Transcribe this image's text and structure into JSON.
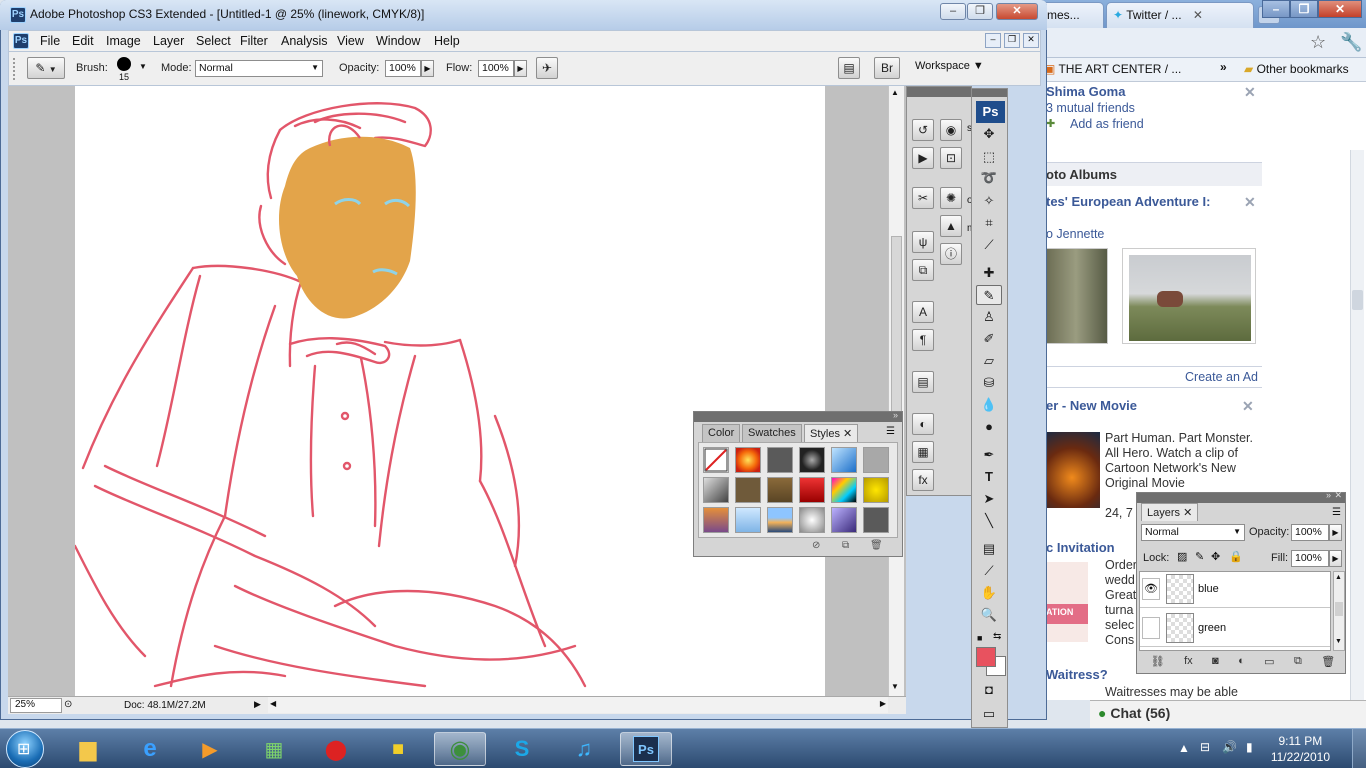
{
  "browser": {
    "tabs": [
      {
        "label": "mes..."
      },
      {
        "label": "Twitter / ..."
      }
    ],
    "bookmarks": [
      {
        "label": "THE ART CENTER / ..."
      },
      {
        "label": "Other bookmarks"
      }
    ],
    "facebook": {
      "friend_name": "Shima Goma",
      "mutual_friends": "3 mutual friends",
      "add_friend": "Add as friend",
      "photo_albums_heading": "oto Albums",
      "album_title": "tes' European Adventure I:",
      "album_owner": "o Jennette",
      "create_ad": "Create an Ad",
      "ad1_title": "er - New Movie",
      "ad1_text": "Part Human. Part Monster. All Hero. Watch a clip of Cartoon Network's New Original Movie",
      "ad1_text2": "24, 7",
      "ad2_title": "c Invitation",
      "ad2_lines": [
        "Order",
        "wedd",
        "Great",
        "turna",
        "selec",
        "Cons"
      ],
      "ad2_image_text": "ATION",
      "ad3_title": "Waitress?",
      "ad3_text": "Waitresses may be able"
    },
    "chat_label": "Chat (56)"
  },
  "photoshop": {
    "title": "Adobe Photoshop CS3 Extended - [Untitled-1 @ 25% (linework, CMYK/8)]",
    "menu": [
      "File",
      "Edit",
      "Image",
      "Layer",
      "Select",
      "Filter",
      "Analysis",
      "View",
      "Window",
      "Help"
    ],
    "options": {
      "brush_label": "Brush:",
      "brush_size": "15",
      "mode_label": "Mode:",
      "mode_value": "Normal",
      "opacity_label": "Opacity:",
      "opacity_value": "100%",
      "flow_label": "Flow:",
      "flow_value": "100%",
      "workspace_label": "Workspace"
    },
    "status": {
      "zoom": "25%",
      "doc": "Doc: 48.1M/27.2M"
    },
    "dock_partial_labels": [
      "s",
      "or",
      "m"
    ],
    "swatch_panel": {
      "tabs": [
        "Color",
        "Swatches",
        "Styles"
      ],
      "active_tab": "Styles"
    },
    "layers_panel": {
      "tab": "Layers",
      "blend_mode": "Normal",
      "opacity_label": "Opacity:",
      "opacity_value": "100%",
      "lock_label": "Lock:",
      "fill_label": "Fill:",
      "fill_value": "100%",
      "layers": [
        {
          "name": "blue",
          "visible": true
        },
        {
          "name": "green",
          "visible": false
        }
      ]
    },
    "foreground_color": "#e8525f",
    "background_color": "#ffffff",
    "toolbox_logo": "Ps"
  },
  "taskbar": {
    "time": "9:11 PM",
    "date": "11/22/2010",
    "apps": [
      "explorer",
      "internet-explorer",
      "media-center",
      "control-panel",
      "acrobat",
      "bird-app",
      "chrome",
      "skype",
      "itunes",
      "photoshop"
    ],
    "active_app": "photoshop"
  }
}
